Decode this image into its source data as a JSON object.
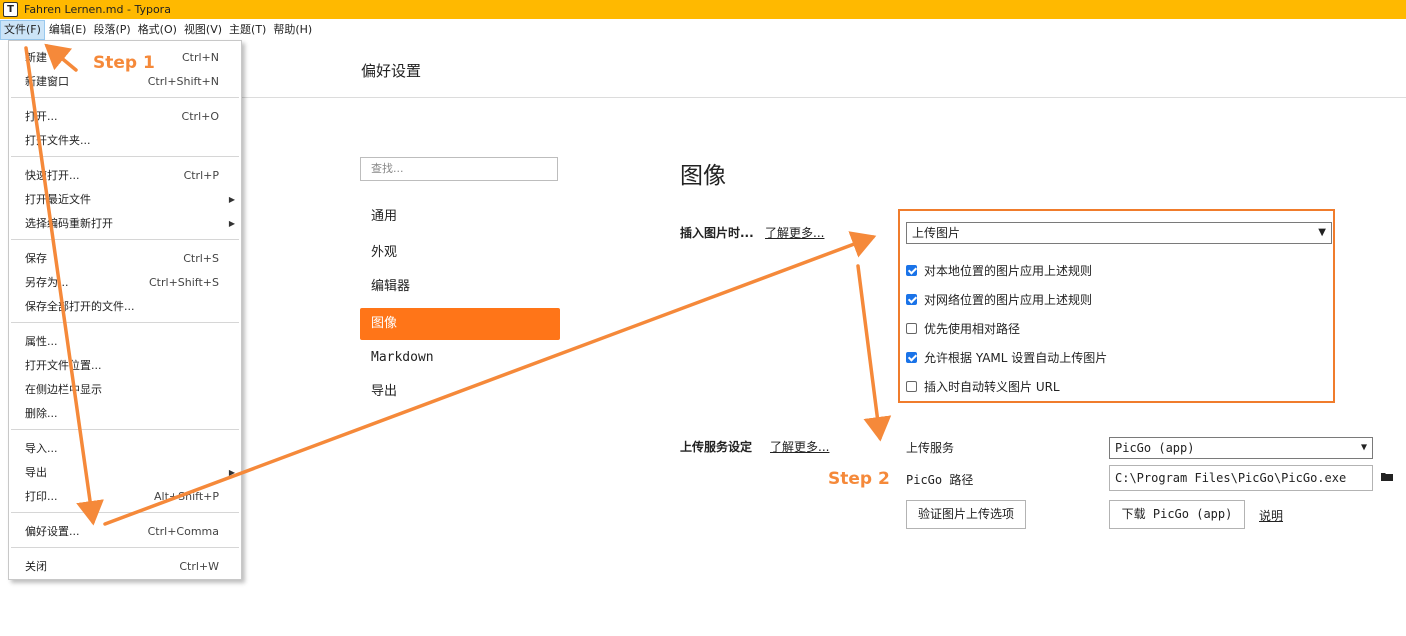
{
  "window": {
    "title": "Fahren Lernen.md - Typora",
    "icon_letter": "T"
  },
  "menubar": [
    "文件(F)",
    "编辑(E)",
    "段落(P)",
    "格式(O)",
    "视图(V)",
    "主题(T)",
    "帮助(H)"
  ],
  "file_menu": [
    {
      "label": "新建",
      "shortcut": "Ctrl+N"
    },
    {
      "label": "新建窗口",
      "shortcut": "Ctrl+Shift+N"
    },
    {
      "label": "打开...",
      "shortcut": "Ctrl+O"
    },
    {
      "label": "打开文件夹...",
      "shortcut": ""
    },
    {
      "label": "快速打开...",
      "shortcut": "Ctrl+P"
    },
    {
      "label": "打开最近文件",
      "shortcut": ""
    },
    {
      "label": "选择编码重新打开",
      "shortcut": ""
    },
    {
      "label": "保存",
      "shortcut": "Ctrl+S"
    },
    {
      "label": "另存为...",
      "shortcut": "Ctrl+Shift+S"
    },
    {
      "label": "保存全部打开的文件...",
      "shortcut": ""
    },
    {
      "label": "属性...",
      "shortcut": ""
    },
    {
      "label": "打开文件位置...",
      "shortcut": ""
    },
    {
      "label": "在侧边栏中显示",
      "shortcut": ""
    },
    {
      "label": "删除...",
      "shortcut": ""
    },
    {
      "label": "导入...",
      "shortcut": ""
    },
    {
      "label": "导出",
      "shortcut": ""
    },
    {
      "label": "打印...",
      "shortcut": "Alt+Shift+P"
    },
    {
      "label": "偏好设置...",
      "shortcut": "Ctrl+Comma"
    },
    {
      "label": "关闭",
      "shortcut": "Ctrl+W"
    }
  ],
  "preferences": {
    "title": "偏好设置",
    "search_placeholder": "查找...",
    "nav": [
      "通用",
      "外观",
      "编辑器",
      "图像",
      "Markdown",
      "导出"
    ],
    "section_title": "图像",
    "insert_label": "插入图片时...",
    "learn_more": "了解更多...",
    "insert_select": "上传图片",
    "checkboxes": [
      {
        "label": "对本地位置的图片应用上述规则",
        "checked": true
      },
      {
        "label": "对网络位置的图片应用上述规则",
        "checked": true
      },
      {
        "label": "优先使用相对路径",
        "checked": false
      },
      {
        "label": "允许根据 YAML 设置自动上传图片",
        "checked": true
      },
      {
        "label": "插入时自动转义图片 URL",
        "checked": false
      }
    ],
    "upload_label": "上传服务设定",
    "upload_service_label": "上传服务",
    "upload_service_value": "PicGo (app)",
    "picgo_path_label": "PicGo 路径",
    "picgo_path_value": "C:\\Program Files\\PicGo\\PicGo.exe",
    "verify_button": "验证图片上传选项",
    "download_button": "下载 PicGo (app)",
    "explain_link": "说明"
  },
  "annotations": {
    "step1": "Step 1",
    "step2": "Step 2",
    "arrow_color": "#f5893a"
  }
}
